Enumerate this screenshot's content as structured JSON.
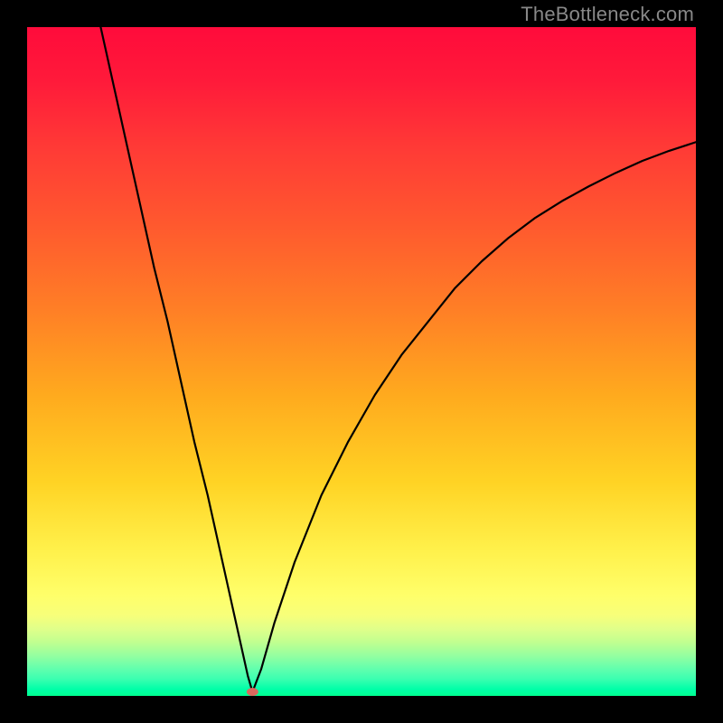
{
  "attribution": "TheBottleneck.com",
  "chart_data": {
    "type": "line",
    "title": "",
    "xlabel": "",
    "ylabel": "",
    "xlim": [
      0,
      100
    ],
    "ylim": [
      0,
      100
    ],
    "grid": false,
    "legend": false,
    "series": [
      {
        "name": "bottleneck-curve",
        "x": [
          11,
          13,
          15,
          17,
          19,
          21,
          23,
          25,
          27,
          29,
          31,
          33,
          33.7,
          35,
          37,
          40,
          44,
          48,
          52,
          56,
          60,
          64,
          68,
          72,
          76,
          80,
          84,
          88,
          92,
          96,
          100
        ],
        "y": [
          100,
          91,
          82,
          73,
          64,
          56,
          47,
          38,
          30,
          21,
          12,
          3,
          0.6,
          4,
          11,
          20,
          30,
          38,
          45,
          51,
          56,
          61,
          65,
          68.5,
          71.5,
          74,
          76.2,
          78.2,
          80,
          81.5,
          82.8
        ]
      }
    ],
    "marker": {
      "x": 33.7,
      "y": 0.6,
      "name": "optimal-point"
    },
    "background_gradient": {
      "orientation": "vertical",
      "stops": [
        {
          "pos": 0.0,
          "color": "#ff0b3b"
        },
        {
          "pos": 0.5,
          "color": "#ffaa1e"
        },
        {
          "pos": 0.85,
          "color": "#ffff6a"
        },
        {
          "pos": 1.0,
          "color": "#00ff90"
        }
      ]
    }
  }
}
